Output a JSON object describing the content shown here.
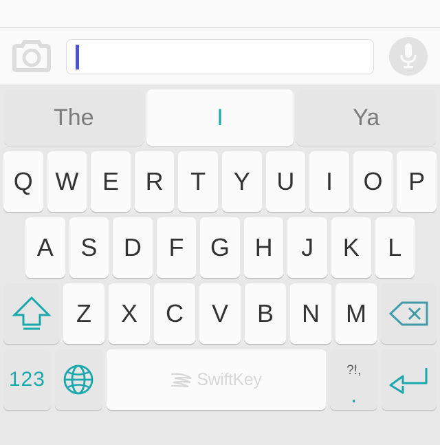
{
  "app": {
    "name": "SwiftKey Keyboard",
    "accent_color": "#1ba8ac",
    "caret_color": "#4b55cf",
    "keyboard_background": "#e8e8e8",
    "key_background": "#fbfbfb",
    "fn_key_background": "#e6e6e6",
    "key_text_color": "#333333"
  },
  "compose_bar": {
    "camera_icon": "camera-icon",
    "mic_icon": "microphone-icon",
    "input": {
      "value": "",
      "placeholder": "",
      "caret_visible": true
    }
  },
  "predictions": {
    "items": [
      {
        "label": "The",
        "active": false
      },
      {
        "label": "I",
        "active": true
      },
      {
        "label": "Ya",
        "active": false
      }
    ]
  },
  "keyboard": {
    "row1": [
      "Q",
      "W",
      "E",
      "R",
      "T",
      "Y",
      "U",
      "I",
      "O",
      "P"
    ],
    "row2": [
      "A",
      "S",
      "D",
      "F",
      "G",
      "H",
      "J",
      "K",
      "L"
    ],
    "row3_letters": [
      "Z",
      "X",
      "C",
      "V",
      "B",
      "N",
      "M"
    ],
    "shift": {
      "icon": "shift-up-arrow-icon",
      "label": ""
    },
    "backspace": {
      "icon": "backspace-delete-icon",
      "label": ""
    },
    "row4": {
      "numbers": {
        "label": "123",
        "icon": "numbers-icon"
      },
      "globe": {
        "icon": "globe-language-icon",
        "label": ""
      },
      "space": {
        "label": "SwiftKey",
        "icon": "swiftkey-logo-icon"
      },
      "punctuation": {
        "top_label": "?!,",
        "main_label": "."
      },
      "enter": {
        "icon": "enter-return-icon",
        "label": ""
      }
    }
  }
}
